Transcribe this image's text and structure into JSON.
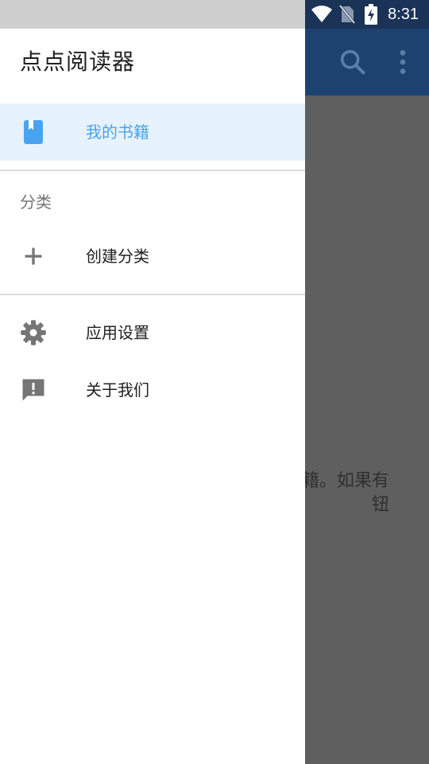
{
  "status_bar": {
    "time": "8:31",
    "icons": [
      "wifi-icon",
      "no-sim-icon",
      "battery-charging-icon"
    ]
  },
  "background_app": {
    "toolbar_icons": [
      "search-icon",
      "more-vert-icon"
    ],
    "empty_text_partial": "籍。如果有\n钮"
  },
  "drawer": {
    "title": "点点阅读器",
    "primary": [
      {
        "label": "我的书籍",
        "icon": "book-icon",
        "active": true
      }
    ],
    "category_section": {
      "header": "分类",
      "items": [
        {
          "label": "创建分类",
          "icon": "add-icon"
        }
      ]
    },
    "secondary": [
      {
        "label": "应用设置",
        "icon": "settings-gear-icon"
      },
      {
        "label": "关于我们",
        "icon": "feedback-icon"
      }
    ]
  },
  "colors": {
    "toolbar": "#1e4270",
    "status_bar_right": "#1b3357",
    "active_accent": "#4aa3f0",
    "active_background": "#e6f2fd",
    "icon_grey": "#757575"
  }
}
